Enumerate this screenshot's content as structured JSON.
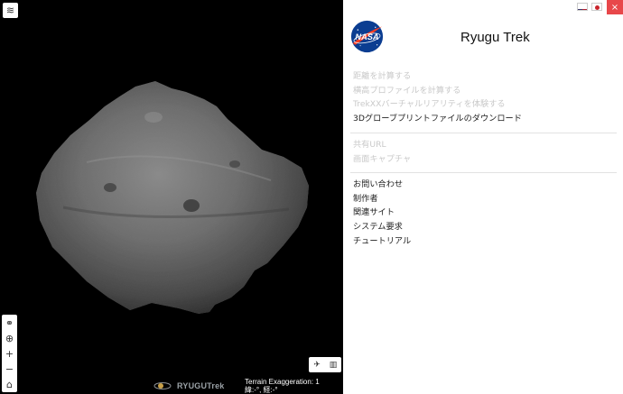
{
  "viewer": {
    "logo_text": "RYUGUTrek",
    "readout_line1": "Terrain Exaggeration: 1",
    "readout_line2": "緯:-°, 経:-°",
    "icons": {
      "layers": "layers-icon",
      "vr": "vr-goggles-icon",
      "globe": "globe-icon",
      "zoom_in": "zoom-in-icon",
      "zoom_out": "zoom-out-icon",
      "home": "home-icon",
      "fly": "airplane-icon",
      "map": "map-icon"
    }
  },
  "panel": {
    "title": "Ryugu Trek",
    "close_label": "×",
    "languages": [
      "en-US",
      "ja-JP"
    ],
    "menu_tools": [
      {
        "label": "距離を計算する",
        "enabled": false
      },
      {
        "label": "横高プロファイルを計算する",
        "enabled": false
      },
      {
        "label": "TrekXXバーチャルリアリティを体験する",
        "enabled": false
      },
      {
        "label": "3Dグローブプリントファイルのダウンロード",
        "enabled": true
      }
    ],
    "menu_share": [
      {
        "label": "共有URL",
        "enabled": false
      },
      {
        "label": "画面キャプチャ",
        "enabled": false
      }
    ],
    "menu_info": [
      {
        "label": "お問い合わせ",
        "enabled": true
      },
      {
        "label": "制作者",
        "enabled": true
      },
      {
        "label": "関連サイト",
        "enabled": true
      },
      {
        "label": "システム要求",
        "enabled": true
      },
      {
        "label": "チュートリアル",
        "enabled": true
      }
    ]
  },
  "colors": {
    "close": "#e8474a",
    "disabled_text": "#c9c9c9",
    "active_text": "#222222",
    "nasa_blue": "#0b3d91",
    "nasa_red": "#fc3d21"
  }
}
